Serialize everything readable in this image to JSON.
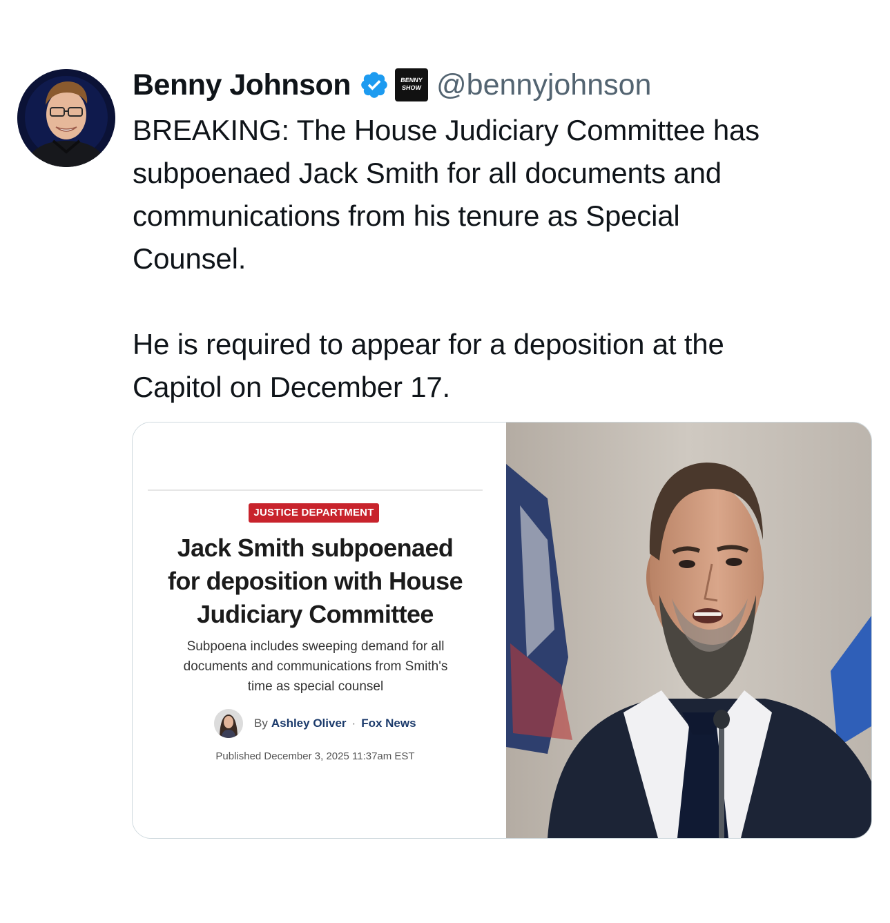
{
  "tweet": {
    "display_name": "Benny Johnson",
    "handle": "@bennyjohnson",
    "verified_icon": "verified-badge-icon",
    "affiliate_badge": [
      "BENNY",
      "SHOW"
    ],
    "text": "BREAKING: The House Judiciary Committee has\nsubpoenaed Jack Smith for all documents and\ncommunications from his tenure as Special\nCounsel.\n\nHe is required to appear for a deposition at the\nCapitol on December 17."
  },
  "card": {
    "tag": "JUSTICE DEPARTMENT",
    "headline": "Jack Smith subpoenaed\nfor deposition with House\nJudiciary Committee",
    "subhead": "Subpoena includes sweeping demand for all\ndocuments and communications from Smith's\ntime as special counsel",
    "by_label": "By",
    "author": "Ashley Oliver",
    "separator": "·",
    "source": "Fox News",
    "published": "Published December 3, 2025 11:37am EST"
  },
  "colors": {
    "verified_blue": "#1d9bf0",
    "tag_red": "#c8232c",
    "handle_gray": "#536471"
  }
}
